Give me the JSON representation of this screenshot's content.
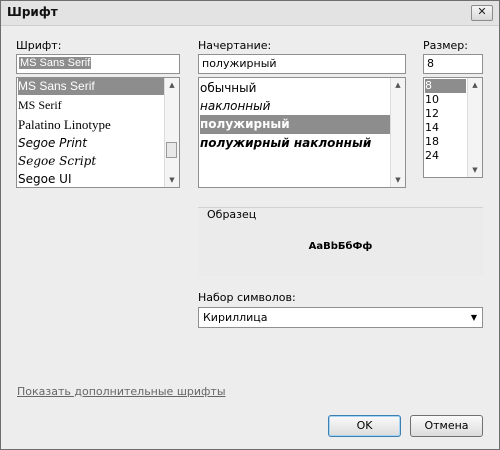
{
  "window": {
    "title": "Шрифт",
    "close_glyph": "✕"
  },
  "font": {
    "label": "Шрифт:",
    "value": "MS Sans Serif",
    "items": [
      {
        "label": "MS Sans Serif"
      },
      {
        "label": "MS Serif"
      },
      {
        "label": "Palatino Linotype"
      },
      {
        "label": "Segoe Print"
      },
      {
        "label": "Segoe Script"
      },
      {
        "label": "Segoe UI"
      }
    ],
    "selected_index": 0
  },
  "style": {
    "label": "Начертание:",
    "value": "полужирный",
    "items": [
      {
        "label": "обычный"
      },
      {
        "label": "наклонный"
      },
      {
        "label": "полужирный"
      },
      {
        "label": "полужирный наклонный"
      }
    ],
    "selected_index": 2
  },
  "size": {
    "label": "Размер:",
    "value": "8",
    "items": [
      {
        "label": "8"
      },
      {
        "label": "10"
      },
      {
        "label": "12"
      },
      {
        "label": "14"
      },
      {
        "label": "18"
      },
      {
        "label": "24"
      }
    ],
    "selected_index": 0
  },
  "sample": {
    "label": "Образец",
    "text": "AaBbБбФф"
  },
  "charset": {
    "label": "Набор символов:",
    "value": "Кириллица"
  },
  "link": {
    "label": "Показать дополнительные шрифты"
  },
  "buttons": {
    "ok": "OK",
    "cancel": "Отмена"
  },
  "icons": {
    "close": "close-icon",
    "scroll_up": "arrow-up-icon",
    "scroll_down": "arrow-down-icon",
    "dropdown": "chevron-down-icon"
  },
  "colors": {
    "selection": "#8d8d8d",
    "background": "#ededed"
  }
}
